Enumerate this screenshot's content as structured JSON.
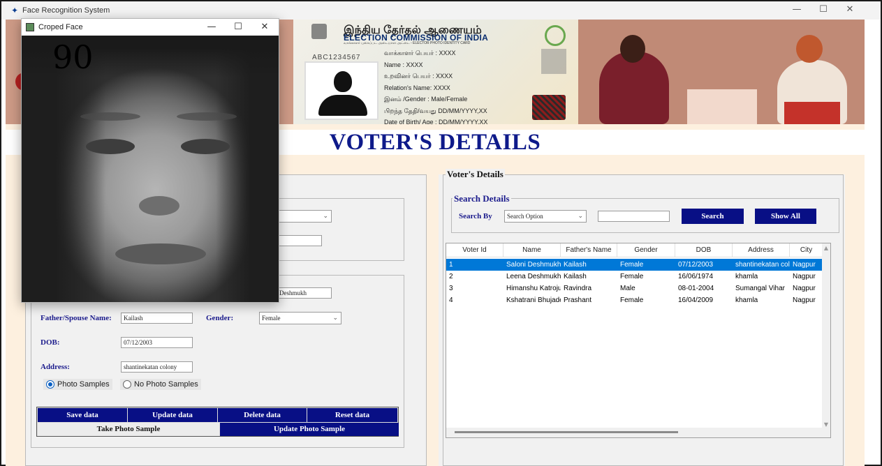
{
  "window": {
    "title": "Face Recognition System",
    "minimize": "—",
    "maximize": "☐",
    "close": "✕",
    "app_icon": "feather-icon"
  },
  "banner": {
    "card": {
      "tamil_title": "இந்திய தேர்தல் ஆணையம்",
      "eci": "ELECTION COMMISSION OF INDIA",
      "subtitle": "வாக்காளர் புகைப்பட அடையாள அட்டை - ELECTOR PHOTO IDENTITY CARD",
      "epic": "ABC1234567",
      "lines": [
        "வாக்காளர் பெயர் : XXXX",
        "Name : XXXX",
        "உறவினர் பெயர் : XXXX",
        "Relation's Name: XXXX",
        "இனம் /Gender : Male/Female",
        "பிறந்த தேதி/வயது DD/MM/YYYY,XX",
        "Date of Birth/ Age : DD/MM/YYYY,XX"
      ]
    }
  },
  "heading": "VOTER'S DETAILS",
  "form": {
    "student_name_value": "Deshmukh",
    "father_label": "Father/Spouse Name:",
    "father_value": "Kailash",
    "gender_label": "Gender:",
    "gender_value": "Female",
    "dob_label": "DOB:",
    "dob_value": "07/12/2003",
    "address_label": "Address:",
    "address_value": "shantinekatan colony",
    "radio_photo": "Photo Samples",
    "radio_nophoto": "No Photo Samples",
    "buttons": {
      "save": "Save data",
      "update": "Update data",
      "delete": "Delete data",
      "reset": "Reset data",
      "take_photo": "Take Photo Sample",
      "update_photo": "Update Photo Sample"
    }
  },
  "right": {
    "panel_title": "Voter's Details",
    "search_title": "Search Details",
    "search_by_label": "Search By",
    "search_option": "Search Option",
    "search_value": "",
    "search_button": "Search",
    "show_all_button": "Show All",
    "columns": [
      "Voter Id",
      "Name",
      "Father's Name",
      "Gender",
      "DOB",
      "Address",
      "City"
    ],
    "rows": [
      [
        "1",
        "Saloni Deshmukh",
        "Kailash",
        "Female",
        "07/12/2003",
        "shantinekatan col",
        "Nagpur"
      ],
      [
        "2",
        "Leena Deshmukh",
        "Kailash",
        "Female",
        "16/06/1974",
        "khamla",
        "Nagpur"
      ],
      [
        "3",
        "Himanshu Katroju",
        "Ravindra",
        "Male",
        "08-01-2004",
        "Sumangal Vihar",
        "Nagpur"
      ],
      [
        "4",
        "Kshatrani Bhujade",
        "Prashant",
        "Female",
        "16/04/2009",
        "khamla",
        "Nagpur"
      ]
    ]
  },
  "popup": {
    "title": "Croped Face",
    "score": "90",
    "minimize": "—",
    "maximize": "☐",
    "close": "✕"
  },
  "colors": {
    "navy": "#080f85",
    "heading": "#0e1a8a",
    "selection": "#0078d7"
  }
}
